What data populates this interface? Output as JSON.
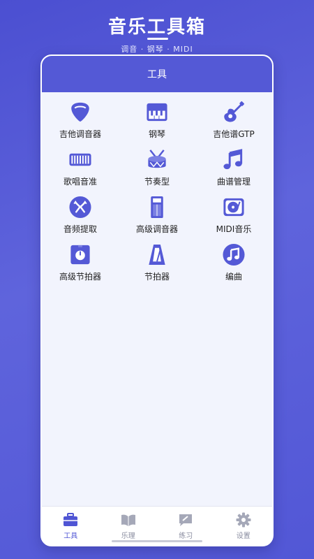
{
  "promo": {
    "title": "音乐工具箱",
    "subtitle": "调音 · 钢琴 · MIDI"
  },
  "header": {
    "title": "工具"
  },
  "tools": [
    {
      "label": "吉他调音器",
      "icon": "guitar-pick-icon"
    },
    {
      "label": "钢琴",
      "icon": "piano-icon"
    },
    {
      "label": "吉他谱GTP",
      "icon": "guitar-icon"
    },
    {
      "label": "歌唱音准",
      "icon": "keyboard-icon"
    },
    {
      "label": "节奏型",
      "icon": "drum-icon"
    },
    {
      "label": "曲谱管理",
      "icon": "music-note-icon"
    },
    {
      "label": "音频提取",
      "icon": "audio-extract-icon"
    },
    {
      "label": "高级调音器",
      "icon": "tuner-device-icon"
    },
    {
      "label": "MIDI音乐",
      "icon": "turntable-icon"
    },
    {
      "label": "高级节拍器",
      "icon": "metronome-square-icon"
    },
    {
      "label": "节拍器",
      "icon": "metronome-icon"
    },
    {
      "label": "编曲",
      "icon": "note-circle-icon"
    }
  ],
  "tabs": [
    {
      "label": "工具",
      "icon": "toolbox-icon",
      "active": true
    },
    {
      "label": "乐理",
      "icon": "book-icon",
      "active": false
    },
    {
      "label": "练习",
      "icon": "practice-icon",
      "active": false
    },
    {
      "label": "设置",
      "icon": "gear-icon",
      "active": false
    }
  ],
  "colors": {
    "accent": "#5459d6",
    "background": "#f2f4fd",
    "inactive_tab": "#a5a8b8"
  }
}
